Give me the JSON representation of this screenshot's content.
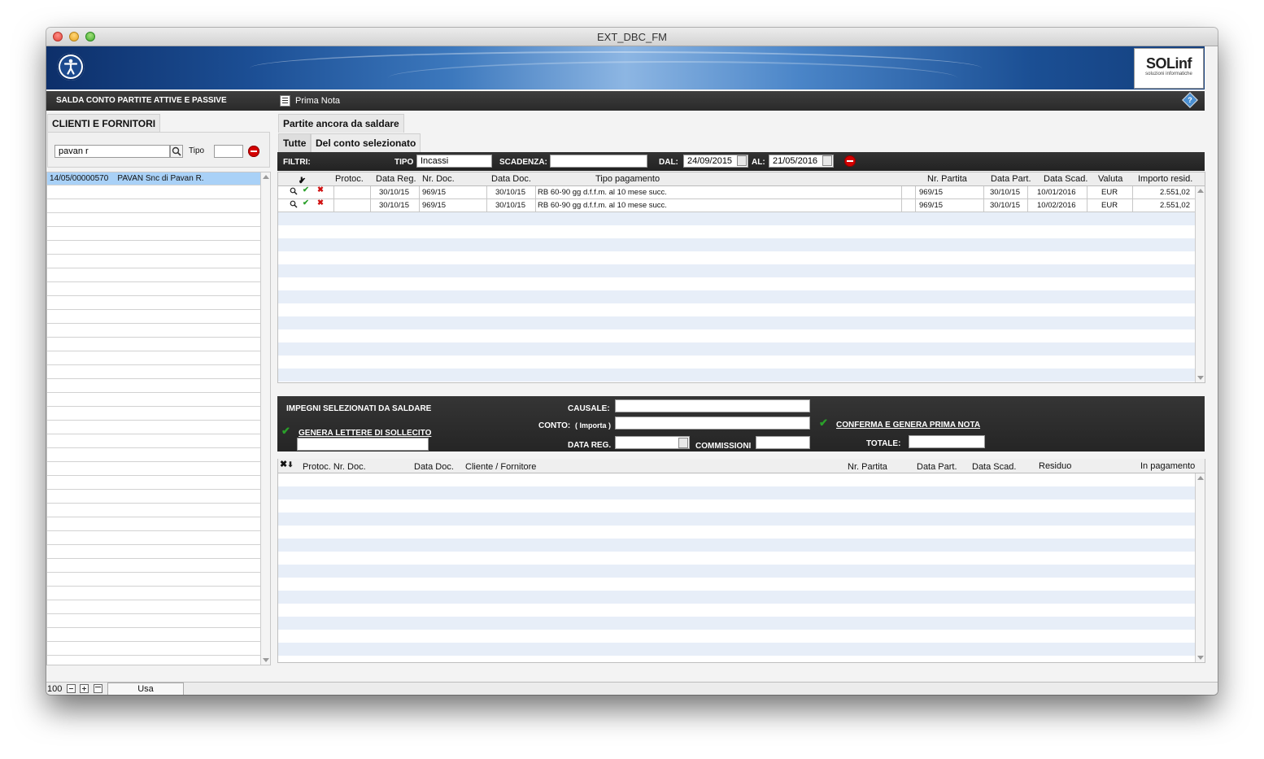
{
  "window": {
    "title": "EXT_DBC_FM"
  },
  "banner": {
    "logo_main": "SOLinf",
    "logo_sub": "soluzioni informatiche"
  },
  "menubar": {
    "left_title": "SALDA CONTO PARTITE ATTIVE E PASSIVE",
    "prima_nota": "Prima Nota",
    "help_label": "?"
  },
  "left": {
    "tab": "CLIENTI E FORNITORI",
    "search_value": "pavan r",
    "tipo_label": "Tipo",
    "tipo_value": "",
    "rows": [
      {
        "code": "14/05/00000570",
        "name": "PAVAN Snc di Pavan R."
      }
    ]
  },
  "right": {
    "tab": "Partite ancora da saldare",
    "subtab_all": "Tutte",
    "subtab_selected": "Del conto selezionato"
  },
  "filters": {
    "label": "FILTRI:",
    "tipo_label": "TIPO",
    "tipo_value": "Incassi",
    "scadenza_label": "SCADENZA:",
    "scadenza_value": "",
    "dal_label": "DAL:",
    "dal_value": "24/09/2015",
    "al_label": "AL:",
    "al_value": "21/05/2016"
  },
  "partite": {
    "columns": {
      "protoc": "Protoc.",
      "data_reg": "Data Reg.",
      "nr_doc": "Nr. Doc.",
      "data_doc": "Data Doc.",
      "tipo_pag": "Tipo pagamento",
      "nr_partita": "Nr. Partita",
      "data_part": "Data Part.",
      "data_scad": "Data Scad.",
      "valuta": "Valuta",
      "importo": "Importo resid."
    },
    "rows": [
      {
        "protoc": "",
        "data_reg": "30/10/15",
        "nr_doc": "969/15",
        "data_doc": "30/10/15",
        "tipo_pag": "RB 60-90 gg d.f.f.m. al 10 mese succ.",
        "nr_partita": "969/15",
        "data_part": "30/10/15",
        "data_scad": "10/01/2016",
        "valuta": "EUR",
        "importo": "2.551,02"
      },
      {
        "protoc": "",
        "data_reg": "30/10/15",
        "nr_doc": "969/15",
        "data_doc": "30/10/15",
        "tipo_pag": "RB 60-90 gg d.f.f.m. al 10 mese succ.",
        "nr_partita": "969/15",
        "data_part": "30/10/15",
        "data_scad": "10/02/2016",
        "valuta": "EUR",
        "importo": "2.551,02"
      }
    ]
  },
  "impegni": {
    "title": "IMPEGNI SELEZIONATI DA SALDARE",
    "genera_lettere": "GENERA LETTERE DI SOLLECITO",
    "causale_label": "CAUSALE:",
    "conto_label": "CONTO:",
    "importa_label": "( Importa )",
    "data_reg_label": "DATA REG.",
    "commissioni_label": "COMMISSIONI",
    "conferma": "CONFERMA E GENERA PRIMA NOTA",
    "totale_label": "TOTALE:"
  },
  "selected": {
    "columns": {
      "protoc_nr_doc": "Protoc. Nr. Doc.",
      "data_doc": "Data Doc.",
      "cliente": "Cliente / Fornitore",
      "nr_partita": "Nr. Partita",
      "data_part": "Data Part.",
      "data_scad": "Data Scad.",
      "residuo": "Residuo",
      "in_pagamento": "In pagamento"
    }
  },
  "statusbar": {
    "zoom": "100",
    "mode": "Usa"
  },
  "colors": {
    "selection": "#a9d1f7",
    "row_alt": "#e7eef8",
    "check": "#2aa02a",
    "delete": "#d01010",
    "banner": "#1c4f95"
  }
}
